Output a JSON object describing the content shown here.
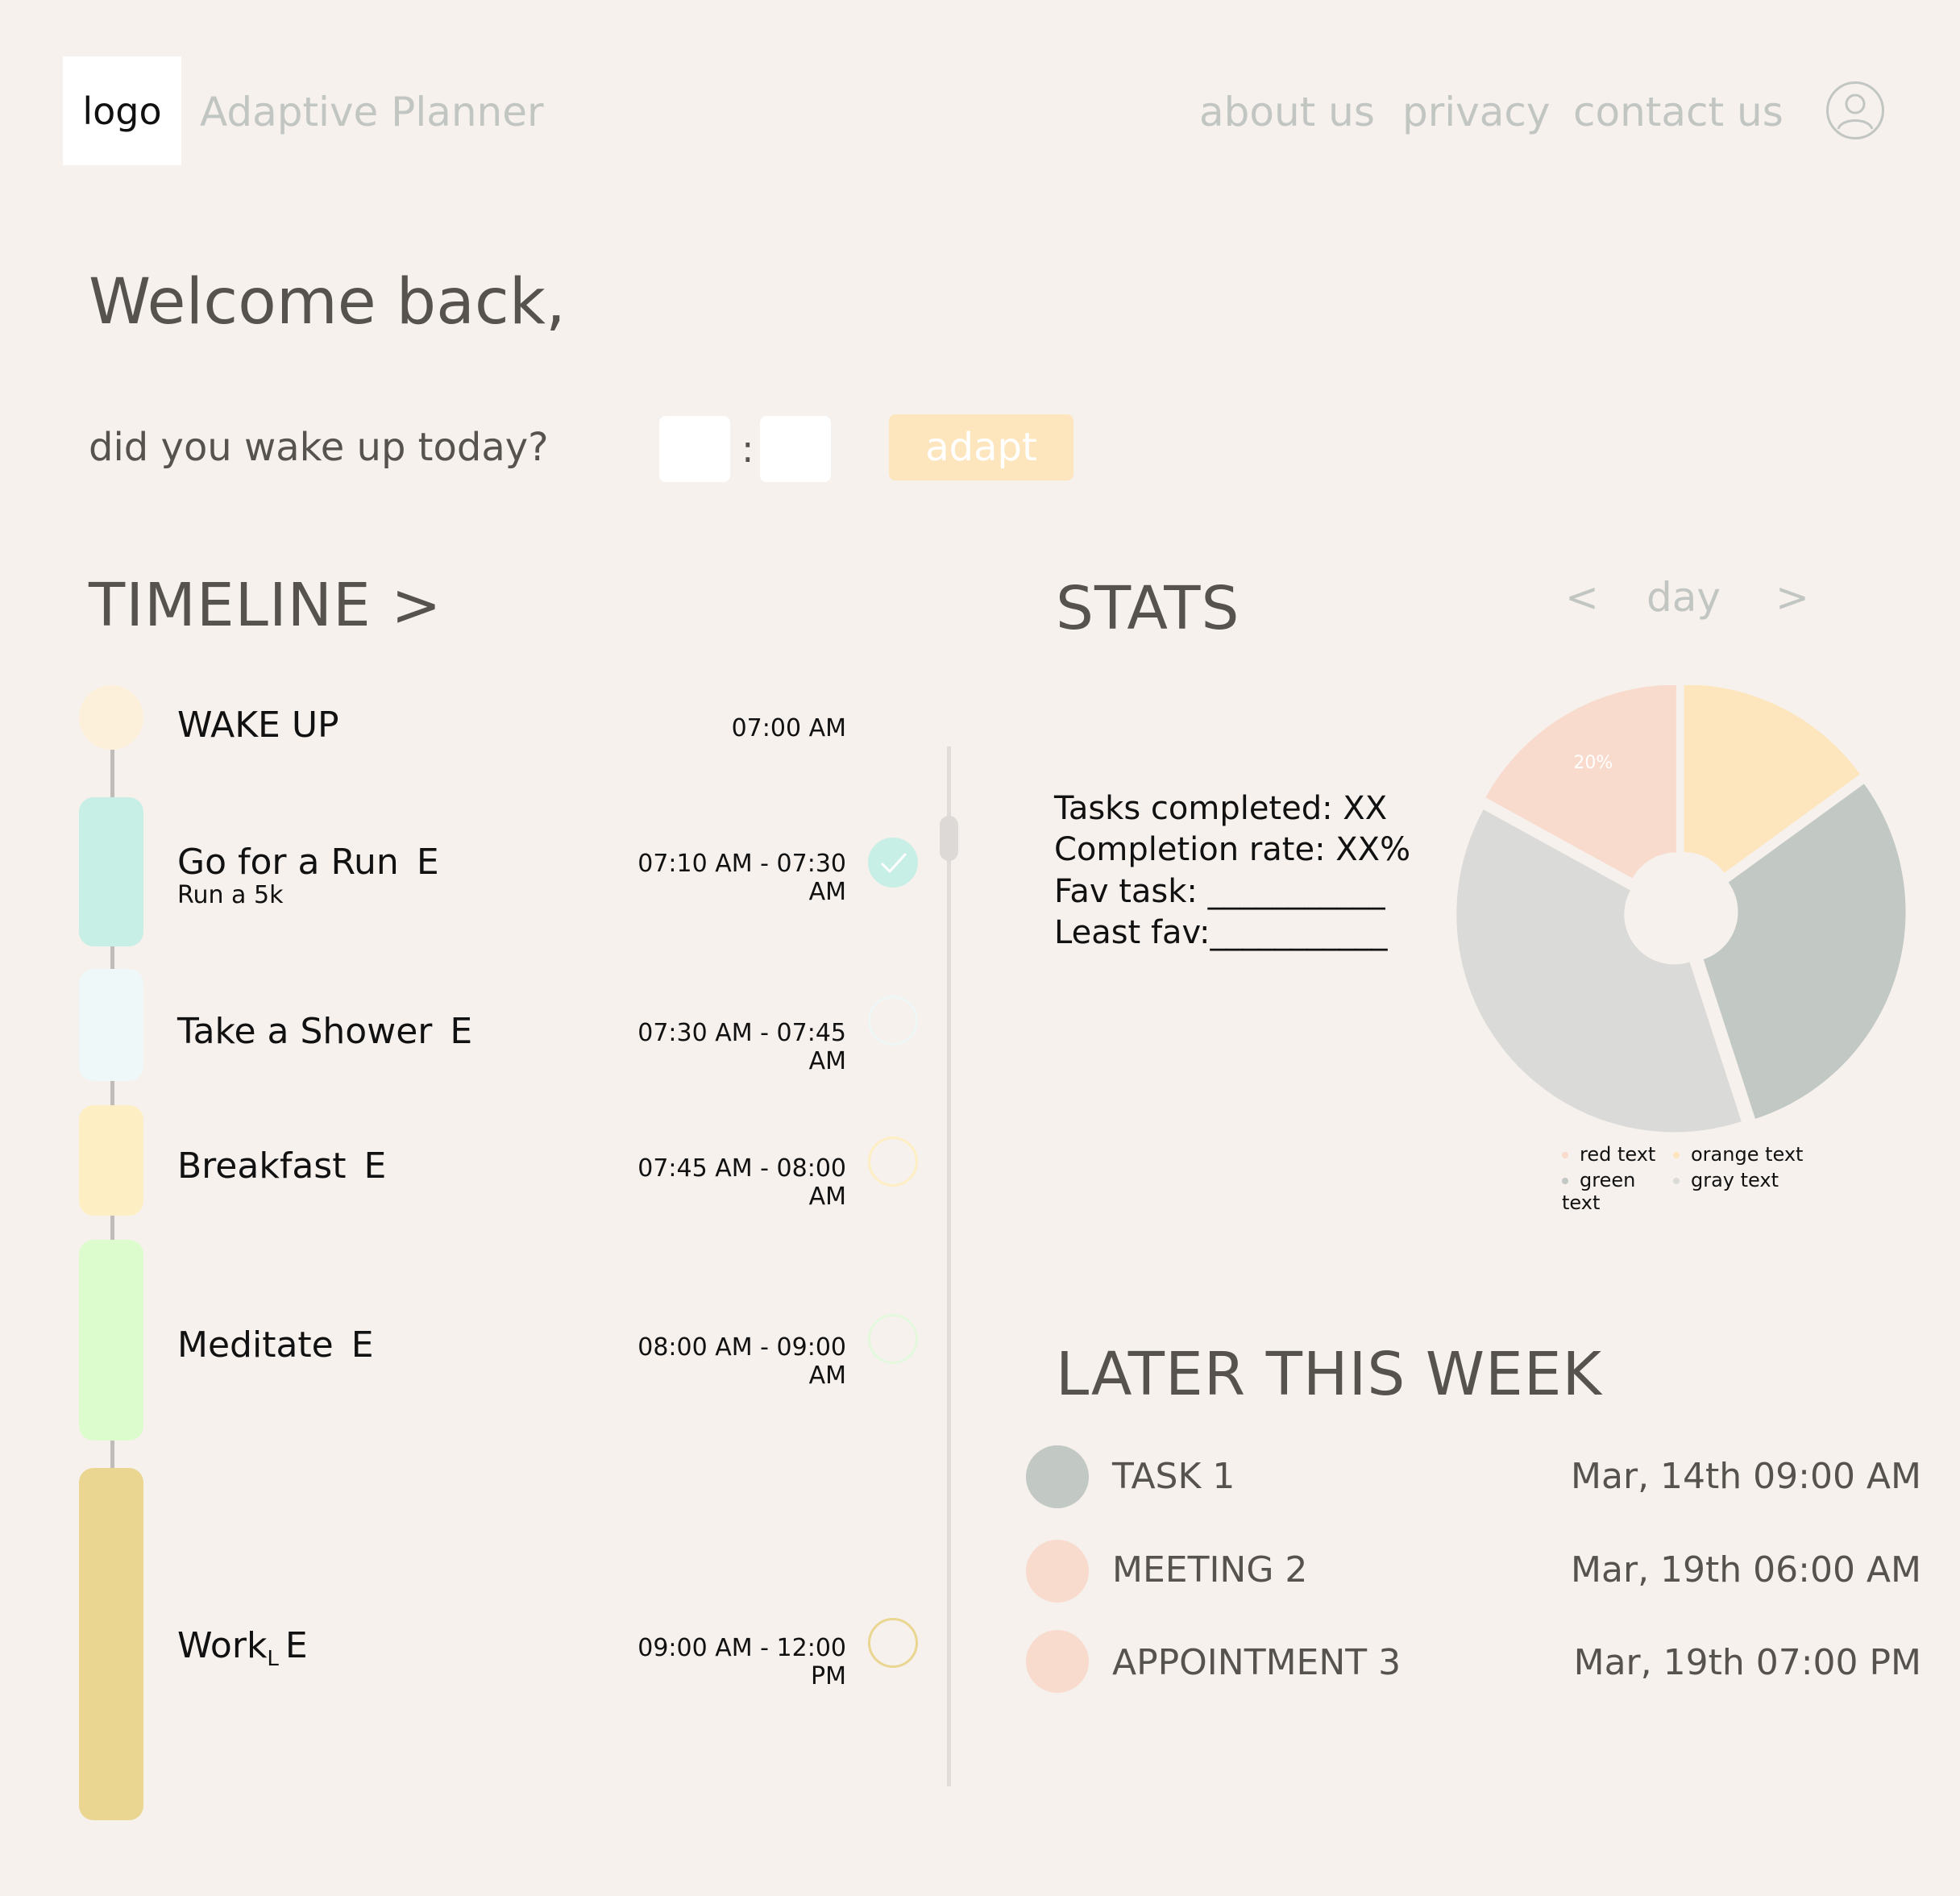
{
  "header": {
    "logo_text": "logo",
    "app_title": "Adaptive Planner",
    "nav": [
      "about us",
      "privacy",
      "contact us"
    ]
  },
  "welcome": {
    "title": "Welcome back,",
    "wake_question": "did you wake up today?",
    "hour_value": "",
    "minute_value": "",
    "colon": ":",
    "adapt_label": "adapt"
  },
  "timeline": {
    "title": "TIMELINE >",
    "tasks": [
      {
        "name": "WAKE UP",
        "edit": "",
        "sub": "",
        "time": "07:00 AM",
        "color": "#fdf0db",
        "done": null
      },
      {
        "name": "Go for a Run",
        "edit": "E",
        "sub": "Run a 5k",
        "time": "07:10 AM - 07:30 AM",
        "color": "#c8efe6",
        "done": true
      },
      {
        "name": "Take a Shower",
        "edit": "E",
        "sub": "",
        "time": "07:30 AM - 07:45 AM",
        "color": "#eef8f8",
        "done": false
      },
      {
        "name": "Breakfast",
        "edit": "E",
        "sub": "",
        "time": "07:45 AM - 08:00 AM",
        "color": "#fdefc3",
        "done": false
      },
      {
        "name": "Meditate",
        "edit": "E",
        "sub": "",
        "time": "08:00 AM - 09:00 AM",
        "color": "#dcfccd",
        "done": false
      },
      {
        "name": "Work",
        "subscript": "L",
        "edit": "E",
        "sub": "",
        "time": "09:00 AM - 12:00 PM",
        "color": "#ead690",
        "done": false
      }
    ]
  },
  "stats": {
    "title": "STATS",
    "nav_prev": "<",
    "period": "day",
    "nav_next": ">",
    "lines": [
      "Tasks completed: XX",
      "Completion rate: XX%",
      "Fav task: ___________",
      "Least fav:___________"
    ]
  },
  "chart_data": {
    "type": "pie",
    "style": "donut, exploded slices",
    "slices": [
      {
        "label": "orange text",
        "value": 15,
        "color": "#fde6bd"
      },
      {
        "label": "green text",
        "value": 30,
        "color": "#c2c8c4"
      },
      {
        "label": "gray text",
        "value": 38,
        "color": "#dadad8"
      },
      {
        "label": "red text",
        "value": 17,
        "color": "#f9dbcd",
        "data_label": "20%"
      }
    ],
    "legend": [
      "red text",
      "orange text",
      "green text",
      "gray text"
    ],
    "legend_colors": [
      "#f9dbcd",
      "#fde6bd",
      "#c2c8c4",
      "#dadad8"
    ],
    "legend_position": "bottom"
  },
  "later_this_week": {
    "title": "LATER THIS WEEK",
    "items": [
      {
        "name": "TASK 1",
        "date": "Mar, 14th 09:00 AM",
        "color": "#c2c8c4"
      },
      {
        "name": "MEETING 2",
        "date": "Mar, 19th 06:00 AM",
        "color": "#f9dbcd"
      },
      {
        "name": "APPOINTMENT 3",
        "date": "Mar, 19th 07:00 PM",
        "color": "#f9dbcd"
      }
    ]
  }
}
